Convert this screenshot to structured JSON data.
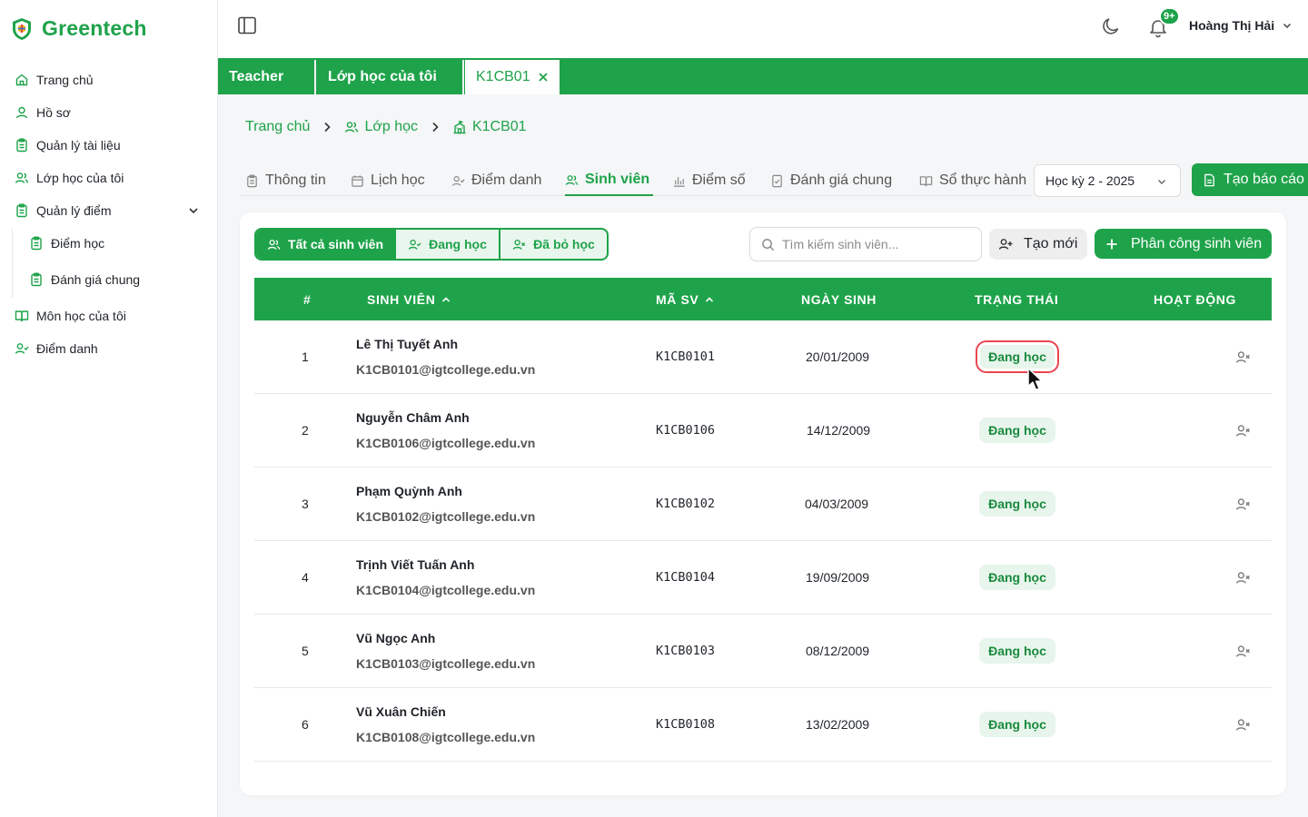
{
  "brand": {
    "name": "Greentech",
    "accent": "#1ea34a"
  },
  "sidebar": {
    "items": [
      {
        "label": "Trang chủ",
        "icon": "home-icon"
      },
      {
        "label": "Hồ sơ",
        "icon": "user-icon"
      },
      {
        "label": "Quản lý tài liệu",
        "icon": "clipboard-icon"
      },
      {
        "label": "Lớp học của tôi",
        "icon": "users-icon"
      },
      {
        "label": "Quản lý điểm",
        "icon": "clipboard-icon",
        "expanded": true
      },
      {
        "label": "Điểm học",
        "icon": "clipboard-icon"
      },
      {
        "label": "Đánh giá chung",
        "icon": "clipboard-icon"
      },
      {
        "label": "Môn học của tôi",
        "icon": "book-open-icon"
      },
      {
        "label": "Điểm danh",
        "icon": "user-check-icon"
      }
    ]
  },
  "header": {
    "notifications_badge": "9+",
    "user_name": "Hoàng Thị Hải"
  },
  "page_tabs": [
    {
      "label": "Teacher"
    },
    {
      "label": "Lớp học của tôi"
    },
    {
      "label": "K1CB01",
      "active": true,
      "closable": true
    }
  ],
  "breadcrumb": {
    "home": "Trang chủ",
    "classes": "Lớp học",
    "current": "K1CB01"
  },
  "sub_tabs": [
    {
      "label": "Thông tin",
      "icon": "clipboard-icon"
    },
    {
      "label": "Lịch học",
      "icon": "calendar-icon"
    },
    {
      "label": "Điểm danh",
      "icon": "user-check-icon"
    },
    {
      "label": "Sinh viên",
      "icon": "users-icon",
      "active": true
    },
    {
      "label": "Điểm số",
      "icon": "bar-chart-icon"
    },
    {
      "label": "Đánh giá chung",
      "icon": "checklist-icon"
    },
    {
      "label": "Sổ thực hành",
      "icon": "book-open-icon"
    }
  ],
  "semester_select": {
    "value": "Học kỳ 2 - 2025"
  },
  "report_button": {
    "label": "Tạo báo cáo"
  },
  "filters": {
    "all": "Tất cả sinh viên",
    "studying": "Đang học",
    "dropped": "Đã bỏ học"
  },
  "search": {
    "placeholder": "Tìm kiếm sinh viên...",
    "value": ""
  },
  "create_button": {
    "label": "Tạo mới"
  },
  "assign_button": {
    "label": "Phân công sinh viên"
  },
  "table": {
    "headers": {
      "index": "#",
      "student": "SINH VIÊN",
      "code": "MÃ SV",
      "dob": "NGÀY SINH",
      "status": "TRẠNG THÁI",
      "action": "HOẠT ĐỘNG"
    },
    "rows": [
      {
        "index": "1",
        "name": "Lê Thị Tuyết Anh",
        "email": "K1CB0101@igtcollege.edu.vn",
        "code": "K1CB0101",
        "dob": "20/01/2009",
        "status": "Đang học"
      },
      {
        "index": "2",
        "name": "Nguyễn Châm Anh",
        "email": "K1CB0106@igtcollege.edu.vn",
        "code": "K1CB0106",
        "dob": "14/12/2009",
        "status": "Đang học"
      },
      {
        "index": "3",
        "name": "Phạm Quỳnh Anh",
        "email": "K1CB0102@igtcollege.edu.vn",
        "code": "K1CB0102",
        "dob": "04/03/2009",
        "status": "Đang học"
      },
      {
        "index": "4",
        "name": "Trịnh Viết Tuấn Anh",
        "email": "K1CB0104@igtcollege.edu.vn",
        "code": "K1CB0104",
        "dob": "19/09/2009",
        "status": "Đang học"
      },
      {
        "index": "5",
        "name": "Vũ Ngọc Anh",
        "email": "K1CB0103@igtcollege.edu.vn",
        "code": "K1CB0103",
        "dob": "08/12/2009",
        "status": "Đang học"
      },
      {
        "index": "6",
        "name": "Vũ Xuân Chiến",
        "email": "K1CB0108@igtcollege.edu.vn",
        "code": "K1CB0108",
        "dob": "13/02/2009",
        "status": "Đang học"
      }
    ]
  },
  "status_colors": {
    "active_bg": "#e7f5ec",
    "active_text": "#1a8a3d",
    "focus_ring": "#e8464f"
  }
}
